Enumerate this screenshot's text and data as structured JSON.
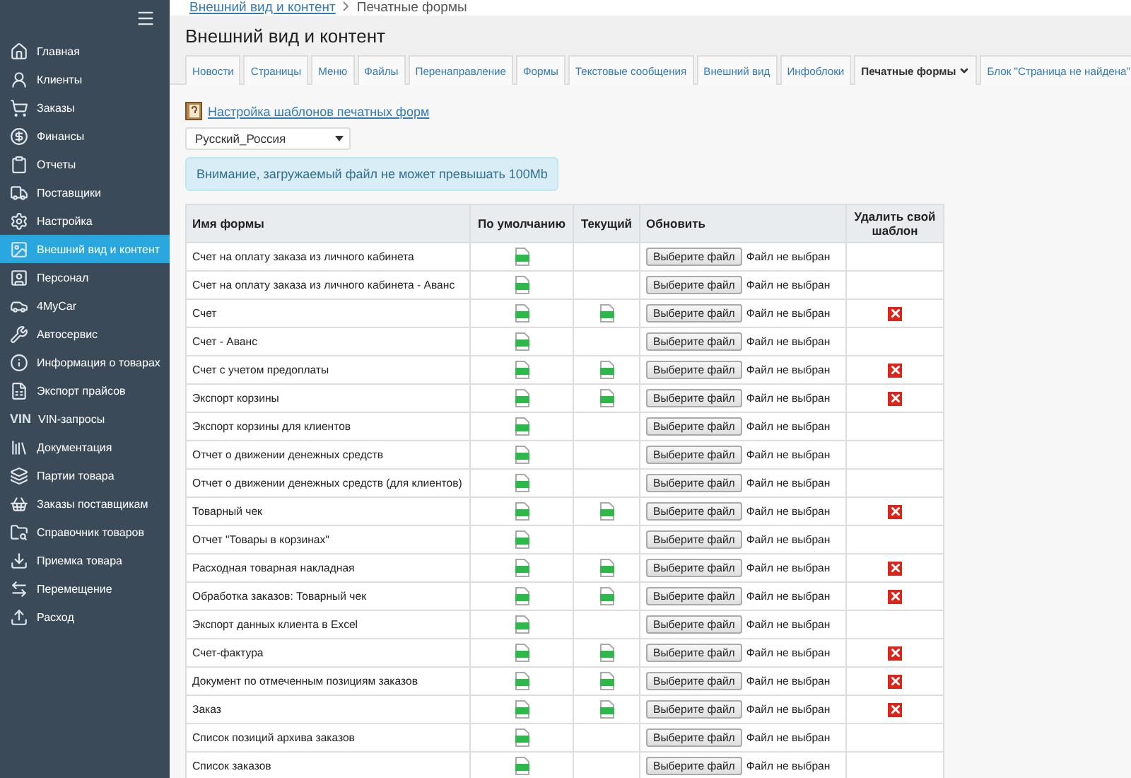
{
  "sidebar": {
    "items": [
      {
        "label": "Главная",
        "selected": false
      },
      {
        "label": "Клиенты",
        "selected": false
      },
      {
        "label": "Заказы",
        "selected": false
      },
      {
        "label": "Финансы",
        "selected": false
      },
      {
        "label": "Отчеты",
        "selected": false
      },
      {
        "label": "Поставщики",
        "selected": false
      },
      {
        "label": "Настройка",
        "selected": false
      },
      {
        "label": "Внешний вид и контент",
        "selected": true
      },
      {
        "label": "Персонал",
        "selected": false
      },
      {
        "label": "4MyCar",
        "selected": false
      },
      {
        "label": "Автосервис",
        "selected": false
      },
      {
        "label": "Информация о товарах",
        "selected": false
      },
      {
        "label": "Экспорт прайсов",
        "selected": false
      },
      {
        "label": "VIN-запросы",
        "selected": false,
        "badge": "VIN"
      },
      {
        "label": "Документация",
        "selected": false
      },
      {
        "label": "Партии товара",
        "selected": false
      },
      {
        "label": "Заказы поставщикам",
        "selected": false
      },
      {
        "label": "Справочник товаров",
        "selected": false
      },
      {
        "label": "Приемка товара",
        "selected": false
      },
      {
        "label": "Перемещение",
        "selected": false
      },
      {
        "label": "Расход",
        "selected": false
      }
    ]
  },
  "breadcrumb": {
    "link": "Внешний вид и контент",
    "current": "Печатные формы"
  },
  "page_title": "Внешний вид и контент",
  "tabs": [
    {
      "label": "Новости",
      "selected": false
    },
    {
      "label": "Страницы",
      "selected": false
    },
    {
      "label": "Меню",
      "selected": false
    },
    {
      "label": "Файлы",
      "selected": false
    },
    {
      "label": "Перенаправление",
      "selected": false
    },
    {
      "label": "Формы",
      "selected": false
    },
    {
      "label": "Текстовые сообщения",
      "selected": false
    },
    {
      "label": "Внешний вид",
      "selected": false
    },
    {
      "label": "Инфоблоки",
      "selected": false
    },
    {
      "label": "Печатные формы",
      "selected": true
    },
    {
      "label": "Блок \"Страница не найдена\"",
      "selected": false
    }
  ],
  "settings_link": "Настройка шаблонов печатных форм",
  "language_select": {
    "value": "Русский_Россия"
  },
  "alert": "Внимание, загружаемый файл не может превышать 100Mb",
  "table": {
    "columns": [
      "Имя формы",
      "По умолчанию",
      "Текущий",
      "Обновить",
      "Удалить свой шаблон"
    ],
    "rows": [
      {
        "name": "Счет на оплату заказа из личного кабинета",
        "default": true,
        "current": false,
        "button": "Выберите файл",
        "file_status": "Файл не выбран",
        "deletable": false
      },
      {
        "name": "Счет на оплату заказа из личного кабинета - Аванс",
        "default": true,
        "current": false,
        "button": "Выберите файл",
        "file_status": "Файл не выбран",
        "deletable": false
      },
      {
        "name": "Счет",
        "default": true,
        "current": true,
        "button": "Выберите файл",
        "file_status": "Файл не выбран",
        "deletable": true
      },
      {
        "name": "Счет - Аванс",
        "default": true,
        "current": false,
        "button": "Выберите файл",
        "file_status": "Файл не выбран",
        "deletable": false
      },
      {
        "name": "Счет с учетом предоплаты",
        "default": true,
        "current": true,
        "button": "Выберите файл",
        "file_status": "Файл не выбран",
        "deletable": true
      },
      {
        "name": "Экспорт корзины",
        "default": true,
        "current": true,
        "button": "Выберите файл",
        "file_status": "Файл не выбран",
        "deletable": true
      },
      {
        "name": "Экспорт корзины для клиентов",
        "default": true,
        "current": false,
        "button": "Выберите файл",
        "file_status": "Файл не выбран",
        "deletable": false
      },
      {
        "name": "Отчет о движении денежных средств",
        "default": true,
        "current": false,
        "button": "Выберите файл",
        "file_status": "Файл не выбран",
        "deletable": false
      },
      {
        "name": "Отчет о движении денежных средств (для клиентов)",
        "default": true,
        "current": false,
        "button": "Выберите файл",
        "file_status": "Файл не выбран",
        "deletable": false
      },
      {
        "name": "Товарный чек",
        "default": true,
        "current": true,
        "button": "Выберите файл",
        "file_status": "Файл не выбран",
        "deletable": true
      },
      {
        "name": "Отчет \"Товары в корзинах\"",
        "default": true,
        "current": false,
        "button": "Выберите файл",
        "file_status": "Файл не выбран",
        "deletable": false
      },
      {
        "name": "Расходная товарная накладная",
        "default": true,
        "current": true,
        "button": "Выберите файл",
        "file_status": "Файл не выбран",
        "deletable": true
      },
      {
        "name": "Обработка заказов: Товарный чек",
        "default": true,
        "current": true,
        "button": "Выберите файл",
        "file_status": "Файл не выбран",
        "deletable": true
      },
      {
        "name": "Экспорт данных клиента в Excel",
        "default": true,
        "current": false,
        "button": "Выберите файл",
        "file_status": "Файл не выбран",
        "deletable": false
      },
      {
        "name": "Счет-фактура",
        "default": true,
        "current": true,
        "button": "Выберите файл",
        "file_status": "Файл не выбран",
        "deletable": true
      },
      {
        "name": "Документ по отмеченным позициям заказов",
        "default": true,
        "current": true,
        "button": "Выберите файл",
        "file_status": "Файл не выбран",
        "deletable": true
      },
      {
        "name": "Заказ",
        "default": true,
        "current": true,
        "button": "Выберите файл",
        "file_status": "Файл не выбран",
        "deletable": true
      },
      {
        "name": "Список позиций архива заказов",
        "default": true,
        "current": false,
        "button": "Выберите файл",
        "file_status": "Файл не выбран",
        "deletable": false
      },
      {
        "name": "Список заказов",
        "default": true,
        "current": false,
        "button": "Выберите файл",
        "file_status": "Файл не выбран",
        "deletable": false
      }
    ]
  }
}
